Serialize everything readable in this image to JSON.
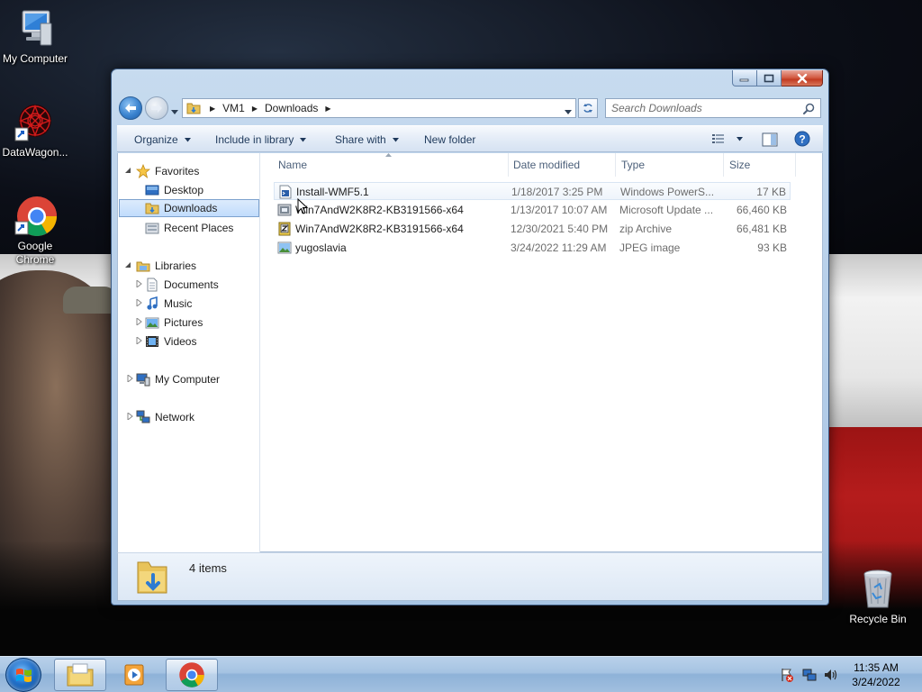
{
  "desktop": {
    "icons": [
      {
        "label": "My Computer"
      },
      {
        "label": "DataWagon..."
      },
      {
        "label": "Google Chrome"
      },
      {
        "label": "Recycle Bin"
      }
    ]
  },
  "window": {
    "breadcrumb": [
      "VM1",
      "Downloads"
    ],
    "search_placeholder": "Search Downloads",
    "toolbar": {
      "organize": "Organize",
      "include_in_library": "Include in library",
      "share_with": "Share with",
      "new_folder": "New folder"
    },
    "nav": {
      "favorites": "Favorites",
      "desktop": "Desktop",
      "downloads": "Downloads",
      "recent_places": "Recent Places",
      "libraries": "Libraries",
      "documents": "Documents",
      "music": "Music",
      "pictures": "Pictures",
      "videos": "Videos",
      "my_computer": "My Computer",
      "network": "Network"
    },
    "columns": {
      "name": "Name",
      "date_modified": "Date modified",
      "type": "Type",
      "size": "Size"
    },
    "files": [
      {
        "name": "Install-WMF5.1",
        "date": "1/18/2017 3:25 PM",
        "type": "Windows PowerS...",
        "size": "17 KB",
        "icon": "powershell-script-icon"
      },
      {
        "name": "Win7AndW2K8R2-KB3191566-x64",
        "date": "1/13/2017 10:07 AM",
        "type": "Microsoft Update ...",
        "size": "66,460 KB",
        "icon": "msu-file-icon"
      },
      {
        "name": "Win7AndW2K8R2-KB3191566-x64",
        "date": "12/30/2021 5:40 PM",
        "type": "zip Archive",
        "size": "66,481 KB",
        "icon": "zip-file-icon"
      },
      {
        "name": "yugoslavia",
        "date": "3/24/2022 11:29 AM",
        "type": "JPEG image",
        "size": "93 KB",
        "icon": "jpeg-file-icon"
      }
    ],
    "status": {
      "item_count": "4 items"
    }
  },
  "taskbar": {
    "clock": {
      "time": "11:35 AM",
      "date": "3/24/2022"
    }
  },
  "colors": {
    "accent": "#3b84d0",
    "selection": "#c1dcfc",
    "close_button": "#c23b22"
  }
}
